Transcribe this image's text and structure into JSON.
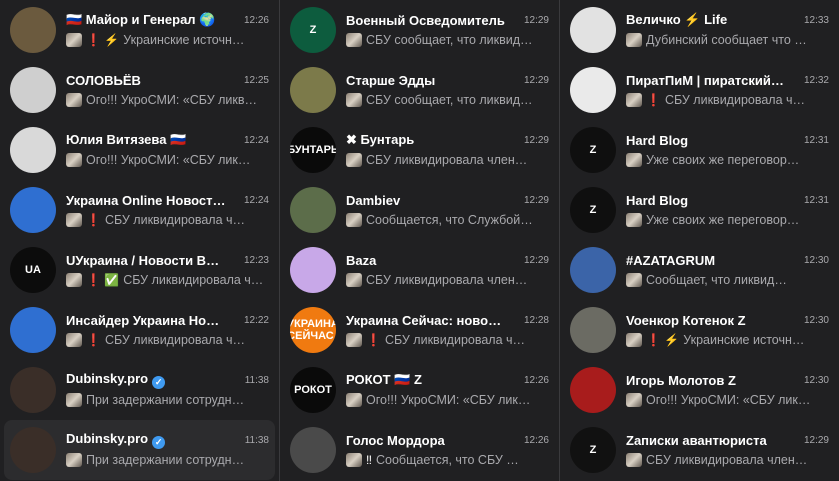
{
  "columns": [
    [
      {
        "name": "🇷🇺 Майор и Генерал 🌍",
        "time": "12:26",
        "prefix": "❗ ⚡",
        "preview": "Украинские источн…",
        "avatar": {
          "bg": "#6b5a3e",
          "text": ""
        }
      },
      {
        "name": "СОЛОВЬЁВ",
        "time": "12:25",
        "prefix": "",
        "preview": "Ого!!! УкроСМИ: «СБУ ликв…",
        "avatar": {
          "bg": "#cfcfcf",
          "text": ""
        }
      },
      {
        "name": "Юлия Витязева 🇷🇺",
        "time": "12:24",
        "prefix": "",
        "preview": "Ого!!! УкроСМИ: «СБУ лик…",
        "avatar": {
          "bg": "#d9d9d9",
          "text": ""
        }
      },
      {
        "name": "Украина Online Новост…",
        "time": "12:24",
        "prefix": "❗",
        "preview": "СБУ ликвидировала ч…",
        "avatar": {
          "bg": "#2f6fd1",
          "text": ""
        }
      },
      {
        "name": "UУкраина / Новости В…",
        "time": "12:23",
        "prefix": "❗ ✅",
        "preview": "СБУ ликвидировала ч…",
        "avatar": {
          "bg": "#0c0c0c",
          "text": "UA"
        }
      },
      {
        "name": "Инсайдер Украина Но…",
        "time": "12:22",
        "prefix": "❗",
        "preview": "СБУ ликвидировала ч…",
        "avatar": {
          "bg": "#2f6fd1",
          "text": ""
        }
      },
      {
        "name": "Dubinsky.pro",
        "verified": true,
        "time": "11:38",
        "prefix": "",
        "preview": "При задержании сотрудн…",
        "avatar": {
          "bg": "#3a2e28",
          "text": ""
        }
      },
      {
        "name": "Dubinsky.pro",
        "verified": true,
        "time": "11:38",
        "prefix": "",
        "preview": "При задержании сотрудн…",
        "avatar": {
          "bg": "#3a2e28",
          "text": ""
        },
        "selected": true
      }
    ],
    [
      {
        "name": "Военный Осведомитель",
        "time": "12:29",
        "prefix": "",
        "preview": "СБУ сообщает, что ликвид…",
        "avatar": {
          "bg": "#0d5c3e",
          "text": "Z"
        }
      },
      {
        "name": "Старше Эдды",
        "time": "12:29",
        "prefix": "",
        "preview": "СБУ сообщает, что ликвид…",
        "avatar": {
          "bg": "#7c7a4a",
          "text": ""
        }
      },
      {
        "name": "✖ Бунтарь",
        "time": "12:29",
        "prefix": "",
        "preview": "СБУ ликвидировала член…",
        "avatar": {
          "bg": "#0a0a0a",
          "text": "БУНТАРЬ"
        }
      },
      {
        "name": "Dambiev",
        "time": "12:29",
        "prefix": "",
        "preview": "Сообщается, что Службой…",
        "avatar": {
          "bg": "#5c6d4a",
          "text": ""
        }
      },
      {
        "name": "Baza",
        "time": "12:29",
        "prefix": "",
        "preview": "СБУ ликвидировала член…",
        "avatar": {
          "bg": "#c8a8e8",
          "text": ""
        }
      },
      {
        "name": "Украина Сейчас: ново…",
        "time": "12:28",
        "prefix": "❗",
        "preview": "СБУ ликвидировала ч…",
        "avatar": {
          "bg": "#f07a10",
          "text": "УКРАИНА СЕЙЧАС"
        }
      },
      {
        "name": "РОКОТ 🇷🇺 Z",
        "time": "12:26",
        "prefix": "",
        "preview": "Ого!!! УкроСМИ: «СБУ лик…",
        "avatar": {
          "bg": "#0a0a0a",
          "text": "РОКОТ"
        }
      },
      {
        "name": "Голос Мордора",
        "time": "12:26",
        "prefix": "‼",
        "preview": "Сообщается, что СБУ …",
        "avatar": {
          "bg": "#4a4a4a",
          "text": ""
        }
      }
    ],
    [
      {
        "name": "Величко ⚡ Life",
        "time": "12:33",
        "prefix": "",
        "preview": "Дубинский сообщает что …",
        "avatar": {
          "bg": "#e2e2e2",
          "text": ""
        }
      },
      {
        "name": "ПиратПиМ | пиратский…",
        "time": "12:32",
        "prefix": "❗",
        "preview": "СБУ ликвидировала ч…",
        "avatar": {
          "bg": "#eaeaea",
          "text": ""
        }
      },
      {
        "name": "Hard Blog",
        "time": "12:31",
        "prefix": "",
        "preview": "Уже своих же переговор…",
        "avatar": {
          "bg": "#0f0f0f",
          "text": "Z"
        }
      },
      {
        "name": "Hard Blog",
        "time": "12:31",
        "prefix": "",
        "preview": "Уже своих же переговор…",
        "avatar": {
          "bg": "#0f0f0f",
          "text": "Z"
        }
      },
      {
        "name": "#AZATAGRUM",
        "time": "12:30",
        "prefix": "",
        "preview": "Сообщает, что ликвид…",
        "avatar": {
          "bg": "#3b64a8",
          "text": ""
        }
      },
      {
        "name": "Voенкор Котенок Z",
        "time": "12:30",
        "prefix": "❗ ⚡",
        "preview": "Украинские источн…",
        "avatar": {
          "bg": "#6b6b63",
          "text": ""
        }
      },
      {
        "name": "Игорь Молотов Z",
        "time": "12:30",
        "prefix": "",
        "preview": "Ого!!! УкроСМИ: «СБУ лик…",
        "avatar": {
          "bg": "#a81c1c",
          "text": ""
        }
      },
      {
        "name": "Zаписки авантюриста",
        "time": "12:29",
        "prefix": "",
        "preview": "СБУ ликвидировала член…",
        "avatar": {
          "bg": "#111111",
          "text": "Z"
        }
      }
    ]
  ]
}
